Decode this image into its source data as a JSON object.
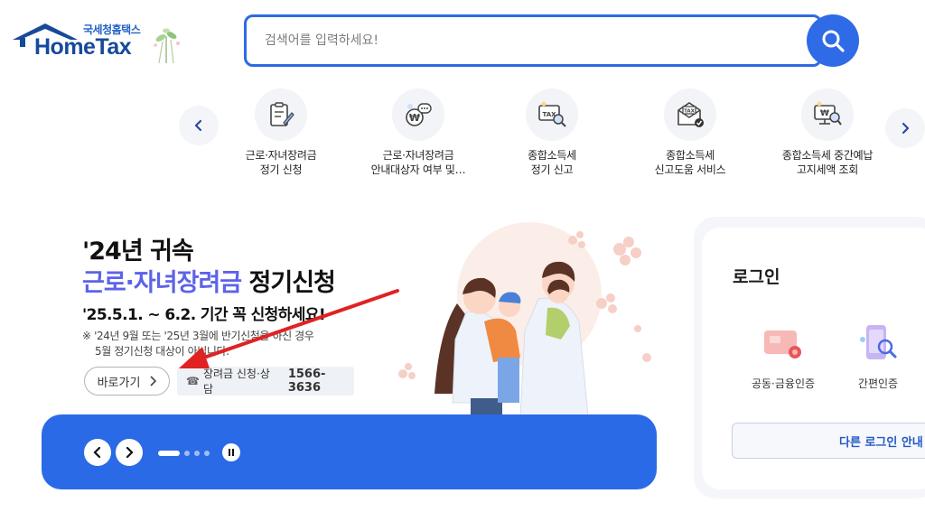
{
  "header": {
    "logo_sub": "국세청홈택스",
    "logo_main": "HomeTax",
    "search_placeholder": "검색어를 입력하세요!"
  },
  "quick_menu": {
    "items": [
      {
        "label_line1": "근로·자녀장려금",
        "label_line2": "정기 신청",
        "icon": "document-pen-icon"
      },
      {
        "label_line1": "근로·자녀장려금",
        "label_line2": "안내대상자 여부 및…",
        "icon": "won-chat-icon"
      },
      {
        "label_line1": "종합소득세",
        "label_line2": "정기 신고",
        "icon": "tax-magnifier-icon"
      },
      {
        "label_line1": "종합소득세",
        "label_line2": "신고도움 서비스",
        "icon": "tax-envelope-check-icon"
      },
      {
        "label_line1": "종합소득세 중간예납",
        "label_line2": "고지세액 조회",
        "icon": "won-monitor-search-icon"
      }
    ]
  },
  "banner": {
    "title_line1": "'24년 귀속",
    "title_highlight": "근로·자녀장려금",
    "title_rest": " 정기신청",
    "period": "'25.5.1. ~ 6.2. 기간 꼭 신청하세요!",
    "note_line1": "※ '24년 9월 또는 '25년 3월에 반기신청을 하신 경우",
    "note_line2": "5월 정기신청 대상이 아닙니다.",
    "go_label": "바로가기",
    "contact_label": "장려금 신청·상담",
    "contact_number": "1566-3636"
  },
  "slider": {
    "dots": 4,
    "active_index": 0
  },
  "login": {
    "title": "로그인",
    "options": [
      {
        "label": "공동·금융인증",
        "icon": "certificate-card-icon"
      },
      {
        "label": "간편인증",
        "icon": "phone-auth-icon"
      }
    ],
    "other_label": "다른 로그인 안내"
  },
  "colors": {
    "brand_blue": "#2b6ae6",
    "logo_navy": "#17499b",
    "highlight_purple": "#5c63e8",
    "annotation_red": "#e02222"
  }
}
